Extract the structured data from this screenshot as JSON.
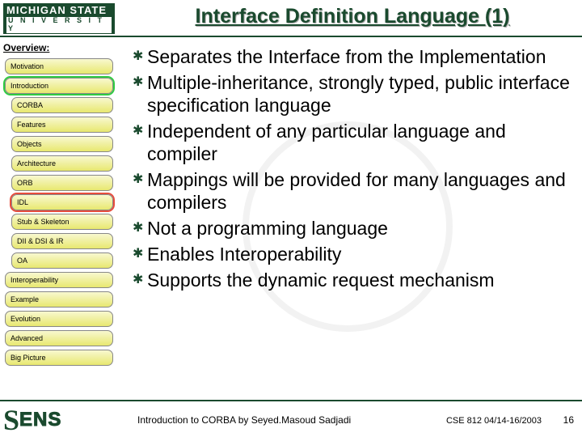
{
  "logo": {
    "line1": "MICHIGAN STATE",
    "line2": "U N I V E R S I T Y"
  },
  "title": "Interface Definition Language (1)",
  "sidebar": {
    "heading": "Overview:",
    "items": [
      {
        "label": "Motivation",
        "indent": false,
        "hi": ""
      },
      {
        "label": "Introduction",
        "indent": false,
        "hi": "green"
      },
      {
        "label": "CORBA",
        "indent": true,
        "hi": ""
      },
      {
        "label": "Features",
        "indent": true,
        "hi": ""
      },
      {
        "label": "Objects",
        "indent": true,
        "hi": ""
      },
      {
        "label": "Architecture",
        "indent": true,
        "hi": ""
      },
      {
        "label": "ORB",
        "indent": true,
        "hi": ""
      },
      {
        "label": "IDL",
        "indent": true,
        "hi": "red"
      },
      {
        "label": "Stub & Skeleton",
        "indent": true,
        "hi": ""
      },
      {
        "label": "DII & DSI & IR",
        "indent": true,
        "hi": ""
      },
      {
        "label": "OA",
        "indent": true,
        "hi": ""
      },
      {
        "label": "Interoperability",
        "indent": false,
        "hi": ""
      },
      {
        "label": "Example",
        "indent": false,
        "hi": ""
      },
      {
        "label": "Evolution",
        "indent": false,
        "hi": ""
      },
      {
        "label": "Advanced",
        "indent": false,
        "hi": ""
      },
      {
        "label": "Big Picture",
        "indent": false,
        "hi": ""
      }
    ]
  },
  "bullets": [
    "Separates the Interface from the Implementation",
    "Multiple-inheritance, strongly typed, public interface specification language",
    "Independent of any particular language and compiler",
    "Mappings will be provided for many languages and compilers",
    "Not a programming language",
    "Enables Interoperability",
    "Supports the dynamic request mechanism"
  ],
  "footer": {
    "credit": "Introduction to CORBA by Seyed.Masoud Sadjadi",
    "course": "CSE 812   04/14-16/2003",
    "page": "16",
    "sens_s": "S",
    "sens_ens": "ENS"
  }
}
